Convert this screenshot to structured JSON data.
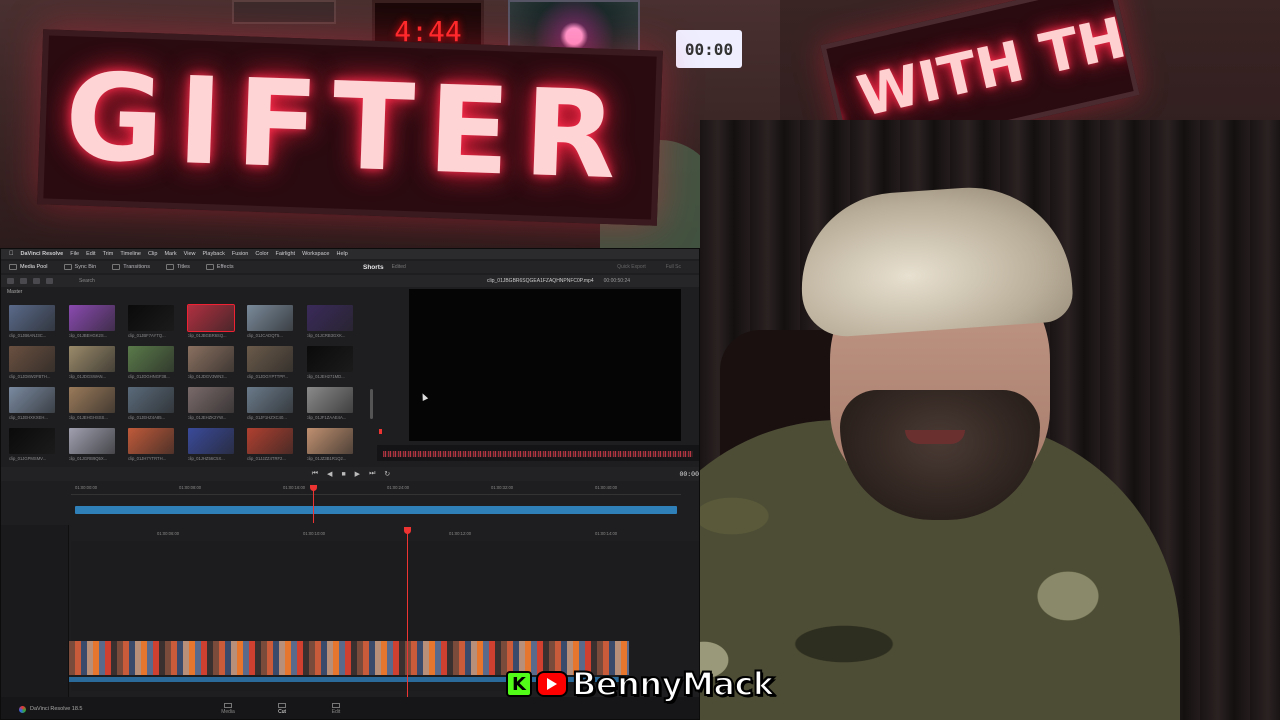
{
  "scene": {
    "led_sign_main": "P GIFTER R",
    "led_sign_right": "R WITH THE",
    "clock_display": "4:44",
    "small_display": "00:00"
  },
  "resolve": {
    "menu": [
      "DaVinci Resolve",
      "File",
      "Edit",
      "Trim",
      "Timeline",
      "Clip",
      "Mark",
      "View",
      "Playback",
      "Fusion",
      "Color",
      "Fairlight",
      "Workspace",
      "Help"
    ],
    "toolbar": {
      "media_pool": "Media Pool",
      "sync_bin": "Sync Bin",
      "transitions": "Transitions",
      "titles": "Titles",
      "effects": "Effects",
      "project_title": "Shorts",
      "project_status": "Edited",
      "quick_export": "Quick Export",
      "full_screen": "Full Sc"
    },
    "pool": {
      "search": "Search",
      "bin": "Master",
      "clips": [
        {
          "label": "clip_01JB6ANJ3C...",
          "color": "#5a6a8a"
        },
        {
          "label": "clip_01JBEHGK2S...",
          "color": "#8a4ab0"
        },
        {
          "label": "clip_01JBF7AYTQ...",
          "color": "#0a0a0a"
        },
        {
          "label": "clip_01JBGBR6SQ...",
          "color": "#b03040"
        },
        {
          "label": "clip_01JCADQT5...",
          "color": "#7a8a9a"
        },
        {
          "label": "clip_01JCRB3GXK...",
          "color": "#3a2a5a"
        },
        {
          "label": "clip_01JD8W2FBTH...",
          "color": "#6a5040"
        },
        {
          "label": "clip_01JDGSWAN...",
          "color": "#9a8a6a"
        },
        {
          "label": "clip_01JDGHNGF38...",
          "color": "#5a7a4a"
        },
        {
          "label": "clip_01JDGV3WN3...",
          "color": "#8a7060"
        },
        {
          "label": "clip_01JDGYPTTPP...",
          "color": "#6a5a4a"
        },
        {
          "label": "clip_01JEH271MD...",
          "color": "#0a0a0a"
        },
        {
          "label": "clip_01JEHXKXEH...",
          "color": "#7a8aa0"
        },
        {
          "label": "clip_01JEHGHSSS...",
          "color": "#9a7a5a"
        },
        {
          "label": "clip_01JEHZ4A85...",
          "color": "#5a6a7a"
        },
        {
          "label": "clip_01JEHZK2YW...",
          "color": "#7a6a6a"
        },
        {
          "label": "clip_01JF1HZXC40...",
          "color": "#6a7a8a"
        },
        {
          "label": "clip_01JF1ZAAE4A...",
          "color": "#8a8a8a"
        },
        {
          "label": "clip_01JGPMSMV...",
          "color": "#0a0a0a"
        },
        {
          "label": "clip_01JGRB9Q5X...",
          "color": "#a0a0b0"
        },
        {
          "label": "clip_01JH7YTRTH...",
          "color": "#c05a3a"
        },
        {
          "label": "clip_01JHZ56C5X...",
          "color": "#3a4a9a"
        },
        {
          "label": "clip_01JJZZ4TRF2...",
          "color": "#b04030"
        },
        {
          "label": "clip_01JZ3B1R1Q2...",
          "color": "#c09070"
        }
      ]
    },
    "viewer": {
      "clip_name": "clip_01JBGBR6SQGEA1FZAQHNPNFC0P.mp4",
      "clip_tc": "00:00:50:24"
    },
    "transport": {
      "timecode": "00:00"
    },
    "upper_ruler": [
      "01:00:00:00",
      "01:00:08:00",
      "01:00:16:00",
      "01:00:24:00",
      "01:00:32:00",
      "01:00:40:00"
    ],
    "lower_ruler": [
      "01:00:06:00",
      "01:00:10:00",
      "01:00:12:00",
      "01:00:14:00"
    ],
    "pages": {
      "brand": "DaVinci Resolve 18.5",
      "media": "Media",
      "cut": "Cut",
      "edit": "Edit"
    }
  },
  "overlay": {
    "handle": "BennyMack",
    "kick_glyph": "K",
    "colors": {
      "kick": "#53fc18",
      "youtube": "#ff0000"
    }
  }
}
